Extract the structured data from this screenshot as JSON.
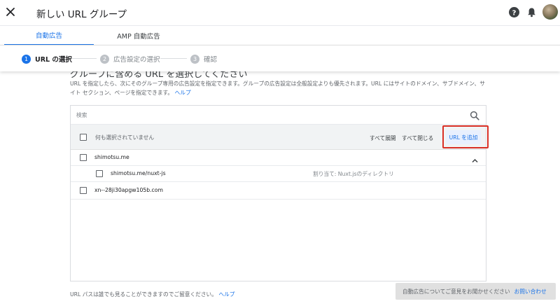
{
  "header": {
    "title": "新しい URL グループ",
    "close_icon": "close-icon",
    "help_icon": "help-icon",
    "notifications_icon": "bell-icon"
  },
  "tabs": [
    {
      "label": "自動広告",
      "active": true
    },
    {
      "label": "AMP 自動広告",
      "active": false
    }
  ],
  "stepper": {
    "steps": [
      {
        "number": "1",
        "label": "URL の選択",
        "active": true
      },
      {
        "number": "2",
        "label": "広告設定の選択",
        "active": false
      },
      {
        "number": "3",
        "label": "確認",
        "active": false
      }
    ]
  },
  "section": {
    "heading": "グループに含める URL を選択してください",
    "description": "URL を指定したら、次にそのグループ専用の広告設定を指定できます。グループの広告設定は全般設定よりも優先されます。URL にはサイトのドメイン、サブドメイン、サイト セクション、ページを指定できます。",
    "help_link": "ヘルプ"
  },
  "url_list": {
    "search_placeholder": "検索",
    "none_selected": "何も選択されていません",
    "expand_all": "すべて展開",
    "collapse_all": "すべて閉じる",
    "add_url": "URL を追加",
    "rows": [
      {
        "url": "shimotsu.me",
        "level": 0,
        "expanded": true
      },
      {
        "url": "shimotsu.me/nuxt-js",
        "level": 1,
        "assignment": "割り当て: Nuxt.jsのディレクトリ"
      },
      {
        "url": "xn--28ji30apgw105b.com",
        "level": 0
      }
    ]
  },
  "footer": {
    "note": "URL パスは誰でも見ることができますのでご留意ください。",
    "help_link": "ヘルプ",
    "feedback_text": "自動広告についてご意見をお聞かせください",
    "feedback_link": "お問い合わせ"
  },
  "colors": {
    "accent": "#1a73e8",
    "highlight": "#d93025",
    "inactive_step": "#bdc1c6"
  }
}
